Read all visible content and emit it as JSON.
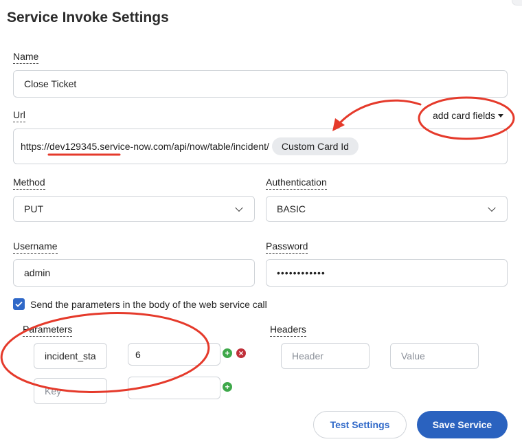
{
  "page": {
    "title": "Service Invoke Settings"
  },
  "name": {
    "label": "Name",
    "value": "Close Ticket"
  },
  "url": {
    "label": "Url",
    "add_fields_label": "add card fields",
    "value": "https://dev129345.service-now.com/api/now/table/incident/",
    "chip": "Custom Card Id"
  },
  "method": {
    "label": "Method",
    "value": "PUT"
  },
  "auth": {
    "label": "Authentication",
    "value": "BASIC"
  },
  "username": {
    "label": "Username",
    "value": "admin"
  },
  "password": {
    "label": "Password",
    "value": "••••••••••••"
  },
  "send_body": {
    "label": "Send the parameters in the body of the web service call",
    "checked": true
  },
  "parameters": {
    "label": "Parameters",
    "rows": [
      {
        "key": "incident_sta",
        "value": "6"
      },
      {
        "key": "",
        "key_placeholder": "Key",
        "value": ""
      }
    ]
  },
  "headers": {
    "label": "Headers",
    "key_placeholder": "Header",
    "value_placeholder": "Value"
  },
  "actions": {
    "test": "Test Settings",
    "save": "Save Service"
  },
  "colors": {
    "primary": "#2a62bf",
    "annotation": "#e53a2b",
    "add": "#3ea84a",
    "remove": "#c0303a"
  }
}
